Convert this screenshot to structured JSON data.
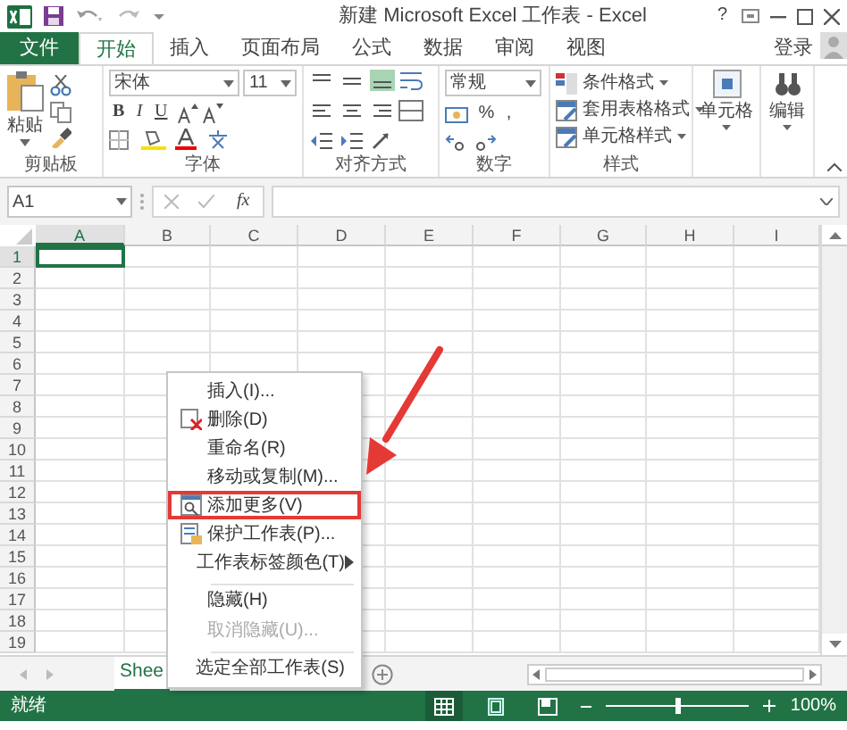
{
  "window": {
    "title": "新建 Microsoft Excel 工作表 - Excel",
    "help": "?"
  },
  "tabs": [
    {
      "label": "文件",
      "kind": "file",
      "selected": false
    },
    {
      "label": "开始",
      "kind": "tab",
      "selected": true
    },
    {
      "label": "插入",
      "kind": "tab",
      "selected": false
    },
    {
      "label": "页面布局",
      "kind": "tab",
      "selected": false
    },
    {
      "label": "公式",
      "kind": "tab",
      "selected": false
    },
    {
      "label": "数据",
      "kind": "tab",
      "selected": false
    },
    {
      "label": "审阅",
      "kind": "tab",
      "selected": false
    },
    {
      "label": "视图",
      "kind": "tab",
      "selected": false
    }
  ],
  "account": {
    "label": "登录"
  },
  "ribbon": {
    "clipboard": {
      "label": "剪贴板",
      "paste": "粘贴"
    },
    "font": {
      "label": "字体",
      "font_name": "宋体",
      "font_size": "11",
      "styles": [
        "B",
        "I",
        "U"
      ]
    },
    "alignment": {
      "label": "对齐方式",
      "vertical": [
        {
          "selected": false
        },
        {
          "selected": false
        },
        {
          "selected": true
        }
      ]
    },
    "number": {
      "label": "数字",
      "format": "常规",
      "percent": "%",
      "comma": ","
    },
    "styles": {
      "label": "样式",
      "commands": [
        "条件格式",
        "套用表格格式",
        "单元格样式"
      ]
    },
    "cells": {
      "label": "单元格"
    },
    "editing": {
      "label": "编辑"
    }
  },
  "formula_bar": {
    "name_box": "A1",
    "fx": "fx"
  },
  "sheet": {
    "columns": [
      {
        "label": "A",
        "selected": true
      },
      {
        "label": "B",
        "selected": false
      },
      {
        "label": "C",
        "selected": false
      },
      {
        "label": "D",
        "selected": false
      },
      {
        "label": "E",
        "selected": false
      },
      {
        "label": "F",
        "selected": false
      },
      {
        "label": "G",
        "selected": false
      },
      {
        "label": "H",
        "selected": false
      },
      {
        "label": "I",
        "selected": false
      }
    ],
    "rows": [
      {
        "label": "1",
        "selected": true
      },
      {
        "label": "2",
        "selected": false
      },
      {
        "label": "3",
        "selected": false
      },
      {
        "label": "4",
        "selected": false
      },
      {
        "label": "5",
        "selected": false
      },
      {
        "label": "6",
        "selected": false
      },
      {
        "label": "7",
        "selected": false
      },
      {
        "label": "8",
        "selected": false
      },
      {
        "label": "9",
        "selected": false
      },
      {
        "label": "10",
        "selected": false
      },
      {
        "label": "11",
        "selected": false
      },
      {
        "label": "12",
        "selected": false
      },
      {
        "label": "13",
        "selected": false
      },
      {
        "label": "14",
        "selected": false
      },
      {
        "label": "15",
        "selected": false
      },
      {
        "label": "16",
        "selected": false
      },
      {
        "label": "17",
        "selected": false
      },
      {
        "label": "18",
        "selected": false
      },
      {
        "label": "19",
        "selected": false
      }
    ]
  },
  "sheet_tabs": [
    {
      "label": "Shee",
      "selected": true
    }
  ],
  "status_bar": {
    "text": "就绪",
    "views": [
      {
        "selected": true
      },
      {
        "selected": false
      },
      {
        "selected": false
      }
    ],
    "zoom": {
      "level": 0.5,
      "reading": "100%"
    }
  },
  "context_menu": {
    "items": [
      {
        "label": "插入(I)...",
        "kind": "plain",
        "disabled": false,
        "submenu": false,
        "separator_before": false,
        "annotated": false
      },
      {
        "label": "删除(D)",
        "kind": "delete",
        "disabled": false,
        "submenu": false,
        "separator_before": false,
        "annotated": false
      },
      {
        "label": "重命名(R)",
        "kind": "plain",
        "disabled": false,
        "submenu": false,
        "separator_before": false,
        "annotated": false
      },
      {
        "label": "移动或复制(M)...",
        "kind": "plain",
        "disabled": false,
        "submenu": false,
        "separator_before": false,
        "annotated": false
      },
      {
        "label": "添加更多(V)",
        "kind": "view",
        "disabled": false,
        "submenu": false,
        "separator_before": false,
        "annotated": true
      },
      {
        "label": "保护工作表(P)...",
        "kind": "protect",
        "disabled": false,
        "submenu": false,
        "separator_before": false,
        "annotated": false
      },
      {
        "label": "工作表标签颜色(T)",
        "kind": "plain",
        "disabled": false,
        "submenu": true,
        "separator_before": false,
        "annotated": false
      },
      {
        "label": "隐藏(H)",
        "kind": "plain",
        "disabled": false,
        "submenu": false,
        "separator_before": true,
        "annotated": false
      },
      {
        "label": "取消隐藏(U)...",
        "kind": "plain",
        "disabled": true,
        "submenu": false,
        "separator_before": false,
        "annotated": false
      },
      {
        "label": "选定全部工作表(S)",
        "kind": "plain",
        "disabled": false,
        "submenu": false,
        "separator_before": true,
        "annotated": false
      }
    ]
  }
}
